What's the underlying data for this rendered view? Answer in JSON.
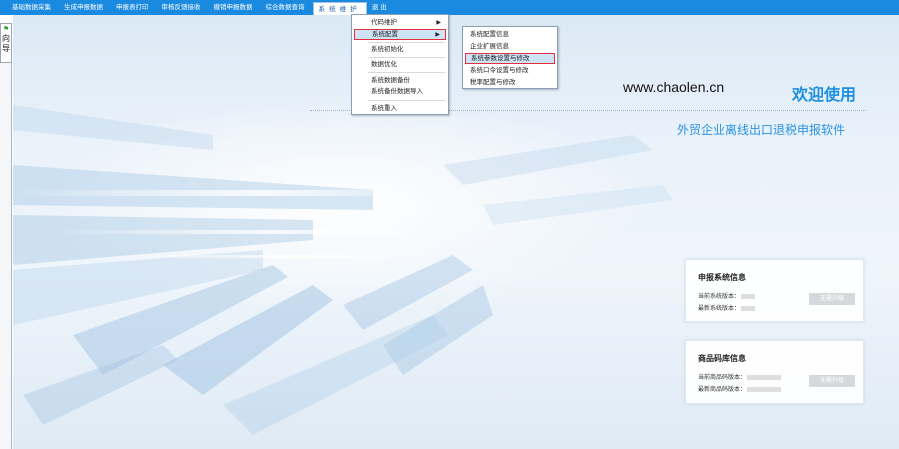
{
  "menubar": {
    "items": [
      "基础数据采集",
      "生成申报数据",
      "申报表打印",
      "审核反馈接收",
      "撤销申报数据",
      "综合数据查询",
      "系 统 维 护",
      "退 出"
    ],
    "active_index": 6
  },
  "guide": {
    "label_1": "向",
    "label_2": "导"
  },
  "menu_system": {
    "code_maintain": "代码维护",
    "sys_config": "系统配置",
    "sys_init": "系统初始化",
    "data_optimize": "数据优化",
    "data_backup": "系统数据备份",
    "backup_import": "系统备份数据导入",
    "sys_reload": "系统重入"
  },
  "submenu_config": {
    "config_info": "系统配置信息",
    "enterprise_info": "企业扩展信息",
    "param_setting": "系统参数设置与修改",
    "password_setting": "系统口令设置与修改",
    "tax_config": "税率配置与修改"
  },
  "welcome": {
    "site": "www.chaolen.cn",
    "title": "欢迎使用",
    "subtitle": "外贸企业离线出口退税申报软件"
  },
  "card_system": {
    "title": "申报系统信息",
    "current_label": "当前系统版本：",
    "latest_label": "最新系统版本：",
    "upgrade": "无需升级"
  },
  "card_codebase": {
    "title": "商品码库信息",
    "current_label": "当前商品码版本：",
    "latest_label": "最新商品码版本：",
    "upgrade": "无需升级"
  },
  "colors": {
    "menubar_bg": "#1a8ae0",
    "accent": "#1d8fe0",
    "highlight_border": "#e0303a"
  }
}
